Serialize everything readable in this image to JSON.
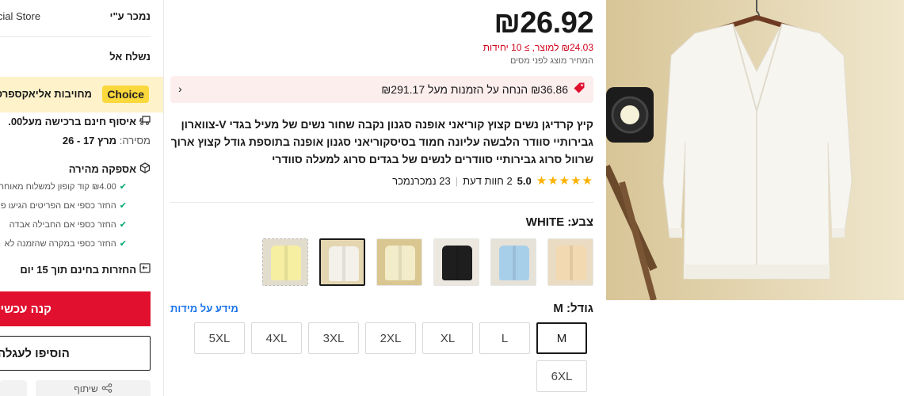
{
  "left_panel": {
    "store_name": "icial Store",
    "seller_label": "נמכר ע\"י",
    "ship_to_label": "נשלח אל",
    "choice_badge": "Choice",
    "choice_text": "מחויבות אליאקספרס",
    "free_pickup": "איסוף חינם ברכישה מעל00.",
    "delivery_label": "מסירה:",
    "delivery_dates": "מרץ 17 - 26",
    "fast_delivery": "אספקה מהירה",
    "benefits": [
      "₪4.00 קוד קופון למשלוח מאוחר",
      "החזר כספי אם הפריטים הגיעו פ",
      "החזר כספי אם החבילה אבדה",
      "החזר כספי במקרה שהזמנה לא"
    ],
    "free_returns": "החזרות בחינם תוך 15 יום",
    "buy_now": "קנה עכשיו",
    "add_to_cart": "הוסיפו לעגלה",
    "share": "שיתוף"
  },
  "product": {
    "price": "₪26.92",
    "unit_price": "₪24.03 למוצר, ≥ 10 יחידות",
    "tax_note": "המחיר מוצג לפני מסים",
    "discount_text": "₪36.86 הנחה על הזמנות מעל ₪291.17",
    "title": "קיץ קרדיגן נשים קצוץ קוריאני אופנה סגנון נקבה שחור נשים של מעיל בגדי V-צווארון גבירותיי סוודר הלבשה עליונה חמוד בסיסקוריאני סגנון אופנה בתוספת גודל קצוץ ארוך שרוול סרוג גבירותיי סוודרים לנשים של בגדים סרוג למעלה סוודרי",
    "rating": "5.0",
    "reviews": "2 חוות דעת",
    "sold": "23 נמכרנמכר",
    "color_label": "צבע: WHITE",
    "size_label": "גודל: M",
    "size_info": "מידע על מידות",
    "colors": [
      {
        "name": "apricot",
        "bg": "#e9dcc2",
        "cardi": "#f3d9b1"
      },
      {
        "name": "sky-blue",
        "bg": "#e7e2d8",
        "cardi": "#a8cfea"
      },
      {
        "name": "black",
        "bg": "#ece8e0",
        "cardi": "#1e1e1e"
      },
      {
        "name": "beige",
        "bg": "#d9c690",
        "cardi": "#f2ecc8"
      },
      {
        "name": "white",
        "bg": "#e4d6b0",
        "cardi": "#f4f1ea"
      },
      {
        "name": "yellow",
        "bg": "#e2dccd",
        "cardi": "#f6efa2"
      }
    ],
    "sizes": [
      "M",
      "L",
      "XL",
      "2XL",
      "3XL",
      "4XL",
      "5XL",
      "6XL"
    ],
    "selected_size": "M"
  }
}
